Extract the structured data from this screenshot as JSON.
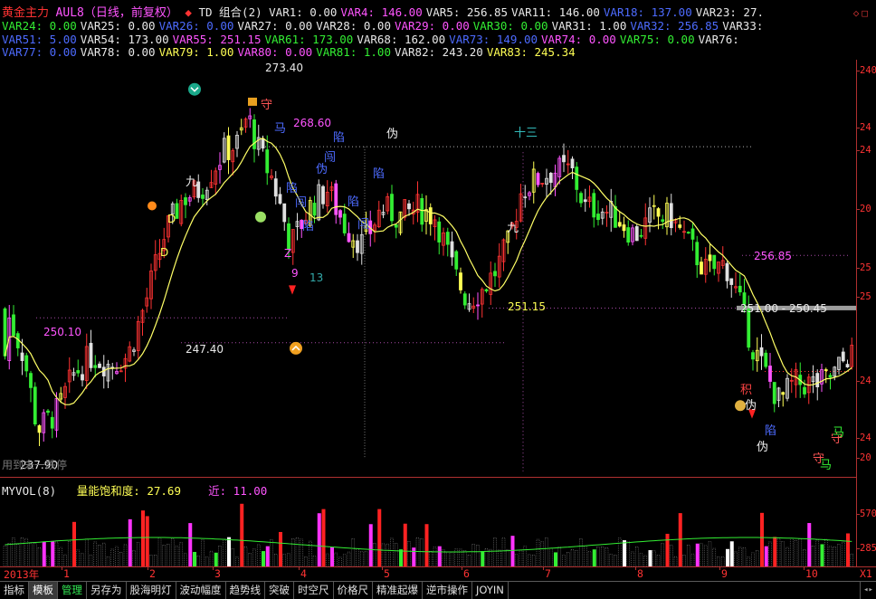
{
  "header": {
    "title": "黄金主力",
    "symbol_info": "AUL8（日线，前复权）",
    "td_label": "TD",
    "combo_label": "组合(2)",
    "rows": [
      [
        {
          "t": "VAR1: 0.00",
          "c": "w"
        },
        {
          "t": "VAR4: 146.00",
          "c": "m"
        },
        {
          "t": "VAR5: 256.85",
          "c": "w"
        },
        {
          "t": "VAR11: 146.00",
          "c": "w"
        },
        {
          "t": "VAR18: 137.00",
          "c": "b"
        },
        {
          "t": "VAR23: 27.",
          "c": "w"
        }
      ],
      [
        {
          "t": "VAR24: 0.00",
          "c": "g"
        },
        {
          "t": "VAR25: 0.00",
          "c": "w"
        },
        {
          "t": "VAR26: 0.00",
          "c": "b"
        },
        {
          "t": "VAR27: 0.00",
          "c": "w"
        },
        {
          "t": "VAR28: 0.00",
          "c": "w"
        },
        {
          "t": "VAR29: 0.00",
          "c": "m"
        },
        {
          "t": "VAR30: 0.00",
          "c": "g"
        },
        {
          "t": "VAR31: 1.00",
          "c": "w"
        },
        {
          "t": "VAR32: 256.85",
          "c": "b"
        },
        {
          "t": "VAR33:",
          "c": "w"
        }
      ],
      [
        {
          "t": "VAR51: 5.00",
          "c": "b"
        },
        {
          "t": "VAR54: 173.00",
          "c": "w"
        },
        {
          "t": "VAR55: 251.15",
          "c": "m"
        },
        {
          "t": "VAR61: 173.00",
          "c": "g"
        },
        {
          "t": "VAR68: 162.00",
          "c": "w"
        },
        {
          "t": "VAR73: 149.00",
          "c": "b"
        },
        {
          "t": "VAR74: 0.00",
          "c": "m"
        },
        {
          "t": "VAR75: 0.00",
          "c": "g"
        },
        {
          "t": "VAR76:",
          "c": "w"
        }
      ],
      [
        {
          "t": "VAR77: 0.00",
          "c": "b"
        },
        {
          "t": "VAR78: 0.00",
          "c": "w"
        },
        {
          "t": "VAR79: 1.00",
          "c": "y"
        },
        {
          "t": "VAR80: 0.00",
          "c": "m"
        },
        {
          "t": "VAR81: 1.00",
          "c": "g"
        },
        {
          "t": "VAR82: 243.20",
          "c": "w"
        },
        {
          "t": "VAR83: 245.34",
          "c": "y"
        }
      ]
    ]
  },
  "main_chart": {
    "price_labels": {
      "high_marker": "273.40",
      "level_268": "268.60",
      "level_256": "256.85",
      "level_251_range": "251.00 - 250.45",
      "level_251": "251.15",
      "level_250": "250.10",
      "level_247": "247.40",
      "low_marker": "237.90"
    },
    "signal_glyphs": {
      "shou": "守",
      "ma": "马",
      "xian": "陷",
      "wei": "伪",
      "ji": "积",
      "jiu": "九",
      "d": "D",
      "z": "Z",
      "nine": "9",
      "thirteen": "13",
      "shi_san": "十三",
      "chuang": "闯",
      "xie": "踩"
    },
    "watermark": "用到未一跌停"
  },
  "volume": {
    "title": "MYVOL(8)",
    "saturation_label": "量能饱和度:",
    "saturation_value": "27.69",
    "recent_label": "近:",
    "recent_value": "11.00"
  },
  "yaxis": {
    "labels": [
      "240",
      "24",
      "24",
      "20",
      "25",
      "25",
      "24",
      "24",
      "20",
      "570",
      "285"
    ]
  },
  "xaxis": {
    "year_label": "2013年",
    "months": [
      "1",
      "2",
      "3",
      "4",
      "5",
      "6",
      "7",
      "8",
      "9",
      "10"
    ],
    "right_label": "X1"
  },
  "tabs": [
    {
      "label": "指标",
      "state": "normal"
    },
    {
      "label": "模板",
      "state": "active"
    },
    {
      "label": "管理",
      "state": "green"
    },
    {
      "label": "另存为",
      "state": "normal"
    },
    {
      "label": "股海明灯",
      "state": "normal"
    },
    {
      "label": "波动幅度",
      "state": "normal"
    },
    {
      "label": "趋势线",
      "state": "normal"
    },
    {
      "label": "突破",
      "state": "normal"
    },
    {
      "label": "时空尺",
      "state": "normal"
    },
    {
      "label": "价格尺",
      "state": "normal"
    },
    {
      "label": "精准起爆",
      "state": "normal"
    },
    {
      "label": "逆市操作",
      "state": "normal"
    },
    {
      "label": "JOYIN",
      "state": "normal"
    }
  ],
  "colors": {
    "up": "#ff3333",
    "down": "#33ee33",
    "ma": "#ffff66",
    "grid_dots": "#a64aa6",
    "axis": "#b03030"
  }
}
